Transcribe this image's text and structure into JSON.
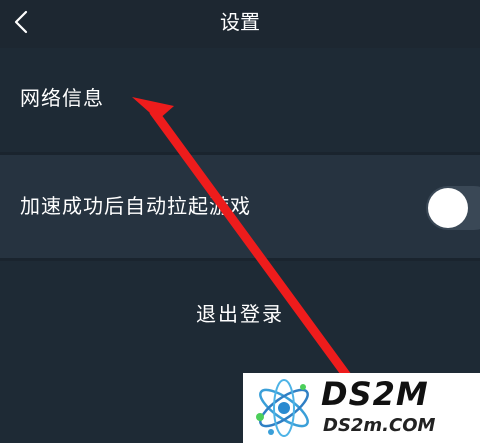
{
  "header": {
    "title": "设置",
    "back_icon": "chevron-left-icon"
  },
  "settings": {
    "network_info_label": "网络信息",
    "auto_launch_label": "加速成功后自动拉起游戏",
    "auto_launch_enabled": false,
    "logout_label": "退出登录"
  },
  "annotation": {
    "arrow_color": "#ee1c1c"
  },
  "watermark": {
    "main_text": "DS2M",
    "sub_text": "DS2m.COM"
  },
  "colors": {
    "background": "#1e2a35",
    "highlight_row": "#263340",
    "toggle_track": "#3a4856",
    "text": "#ffffff"
  }
}
